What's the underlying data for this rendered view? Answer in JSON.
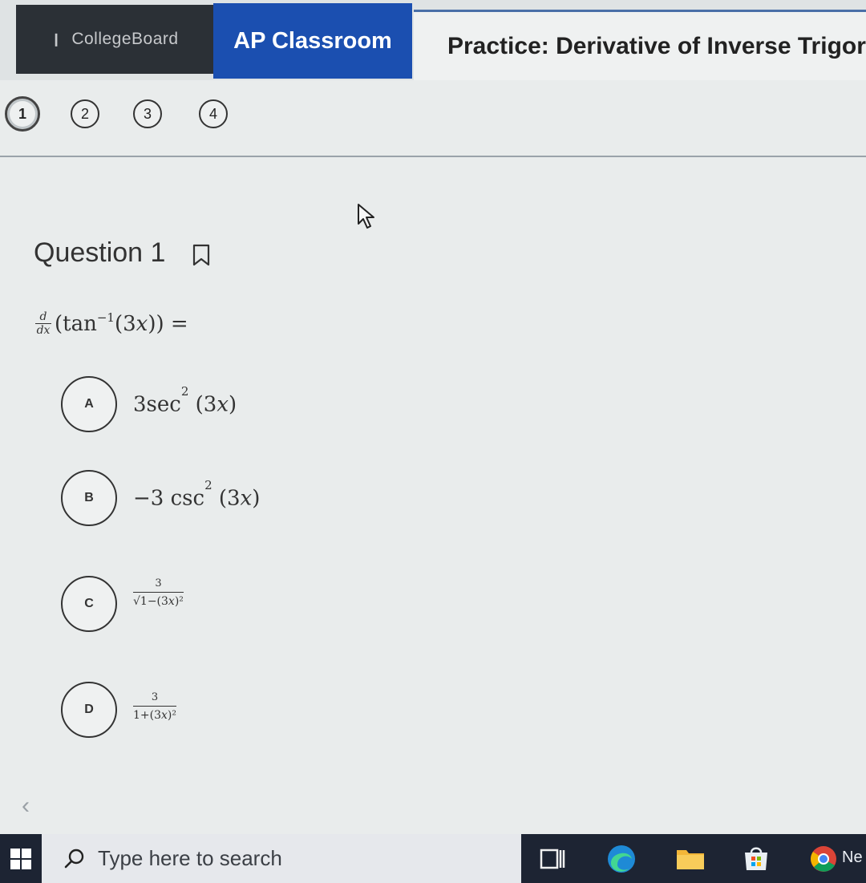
{
  "header": {
    "collegeboard_label": "CollegeBoard",
    "ap_classroom_label": "AP Classroom",
    "practice_title": "Practice: Derivative of Inverse Trigor"
  },
  "question_nav": {
    "items": [
      "1",
      "2",
      "3",
      "4"
    ],
    "active": "1"
  },
  "question": {
    "title": "Question 1",
    "stem": {
      "d": "d",
      "dx": "dx",
      "open": "(tan",
      "exp": "−1",
      "arg": " (3𝑥)) ="
    },
    "choices": [
      {
        "letter": "A",
        "base": "3sec",
        "exp": "2",
        "arg": " (3𝑥)"
      },
      {
        "letter": "B",
        "base": "−3 csc",
        "exp": "2",
        "arg": " (3𝑥)"
      },
      {
        "letter": "C",
        "num": "3",
        "den": "√1−(3𝑥)²"
      },
      {
        "letter": "D",
        "num": "3",
        "den": "1+(3𝑥)²"
      }
    ]
  },
  "taskbar": {
    "search_placeholder": "Type here to search",
    "ne_label": "Ne"
  },
  "colors": {
    "ap_blue": "#1b4fb0",
    "collegeboard_dark": "#2b3036",
    "taskbar": "#1d2433"
  }
}
